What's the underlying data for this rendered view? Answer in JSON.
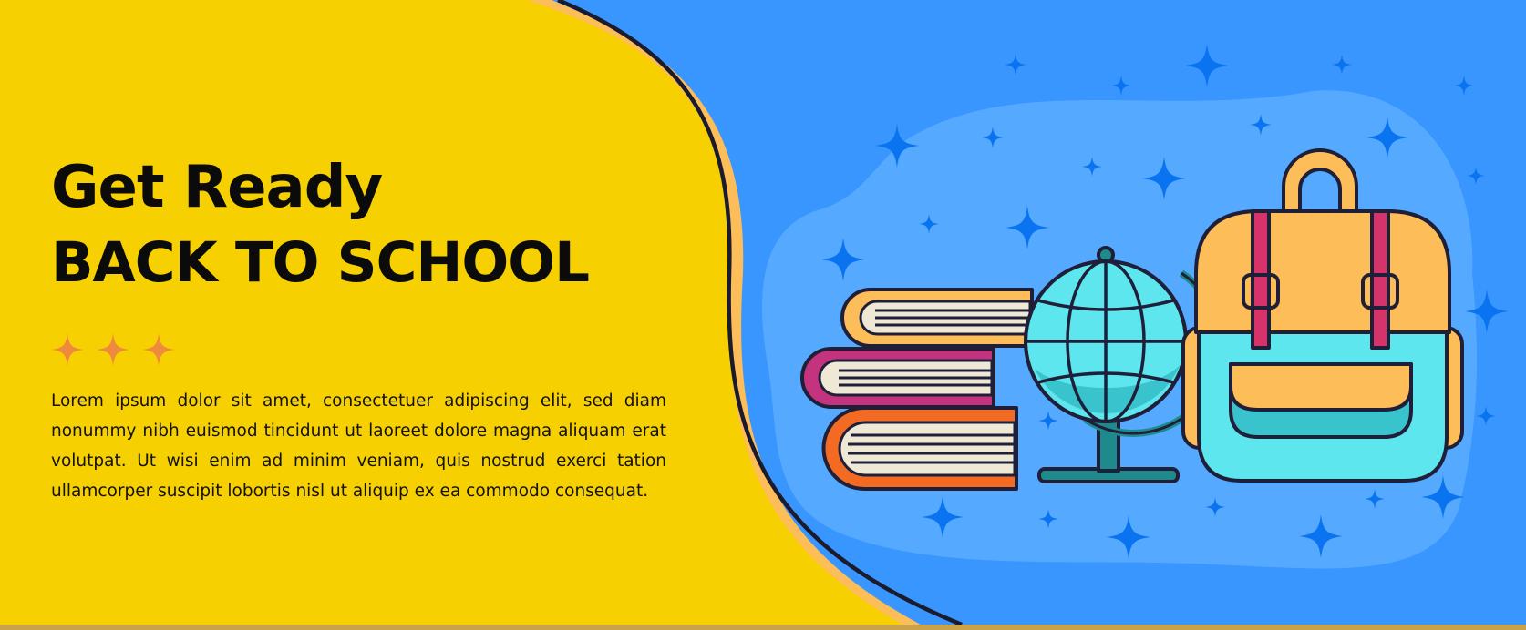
{
  "banner": {
    "heading_line1": "Get Ready",
    "heading_line2": "BACK TO SCHOOL",
    "body_text": "Lorem ipsum dolor sit amet, consectetuer adipiscing elit, sed diam nonummy nibh euismod tincidunt ut laoreet dolore magna aliquam erat volutpat. Ut wisi enim ad minim veniam, quis nostrud exerci tation ullamcorper suscipit lobortis nisl ut aliquip ex ea commodo consequat."
  },
  "decorations": {
    "stars": [
      "orange-star-icon",
      "orange-star-icon",
      "orange-star-icon"
    ],
    "illustration": [
      "book-stack-icon",
      "globe-icon",
      "backpack-icon",
      "sparkle-star-icon"
    ]
  },
  "colors": {
    "yellow_panel": "#f6d000",
    "blue_panel": "#3a96ff",
    "light_blue_blob": "#55aaff",
    "accent_orange": "#ef8a3c",
    "text_dark": "#0b0b0b",
    "star_blue": "#0a73ef"
  }
}
